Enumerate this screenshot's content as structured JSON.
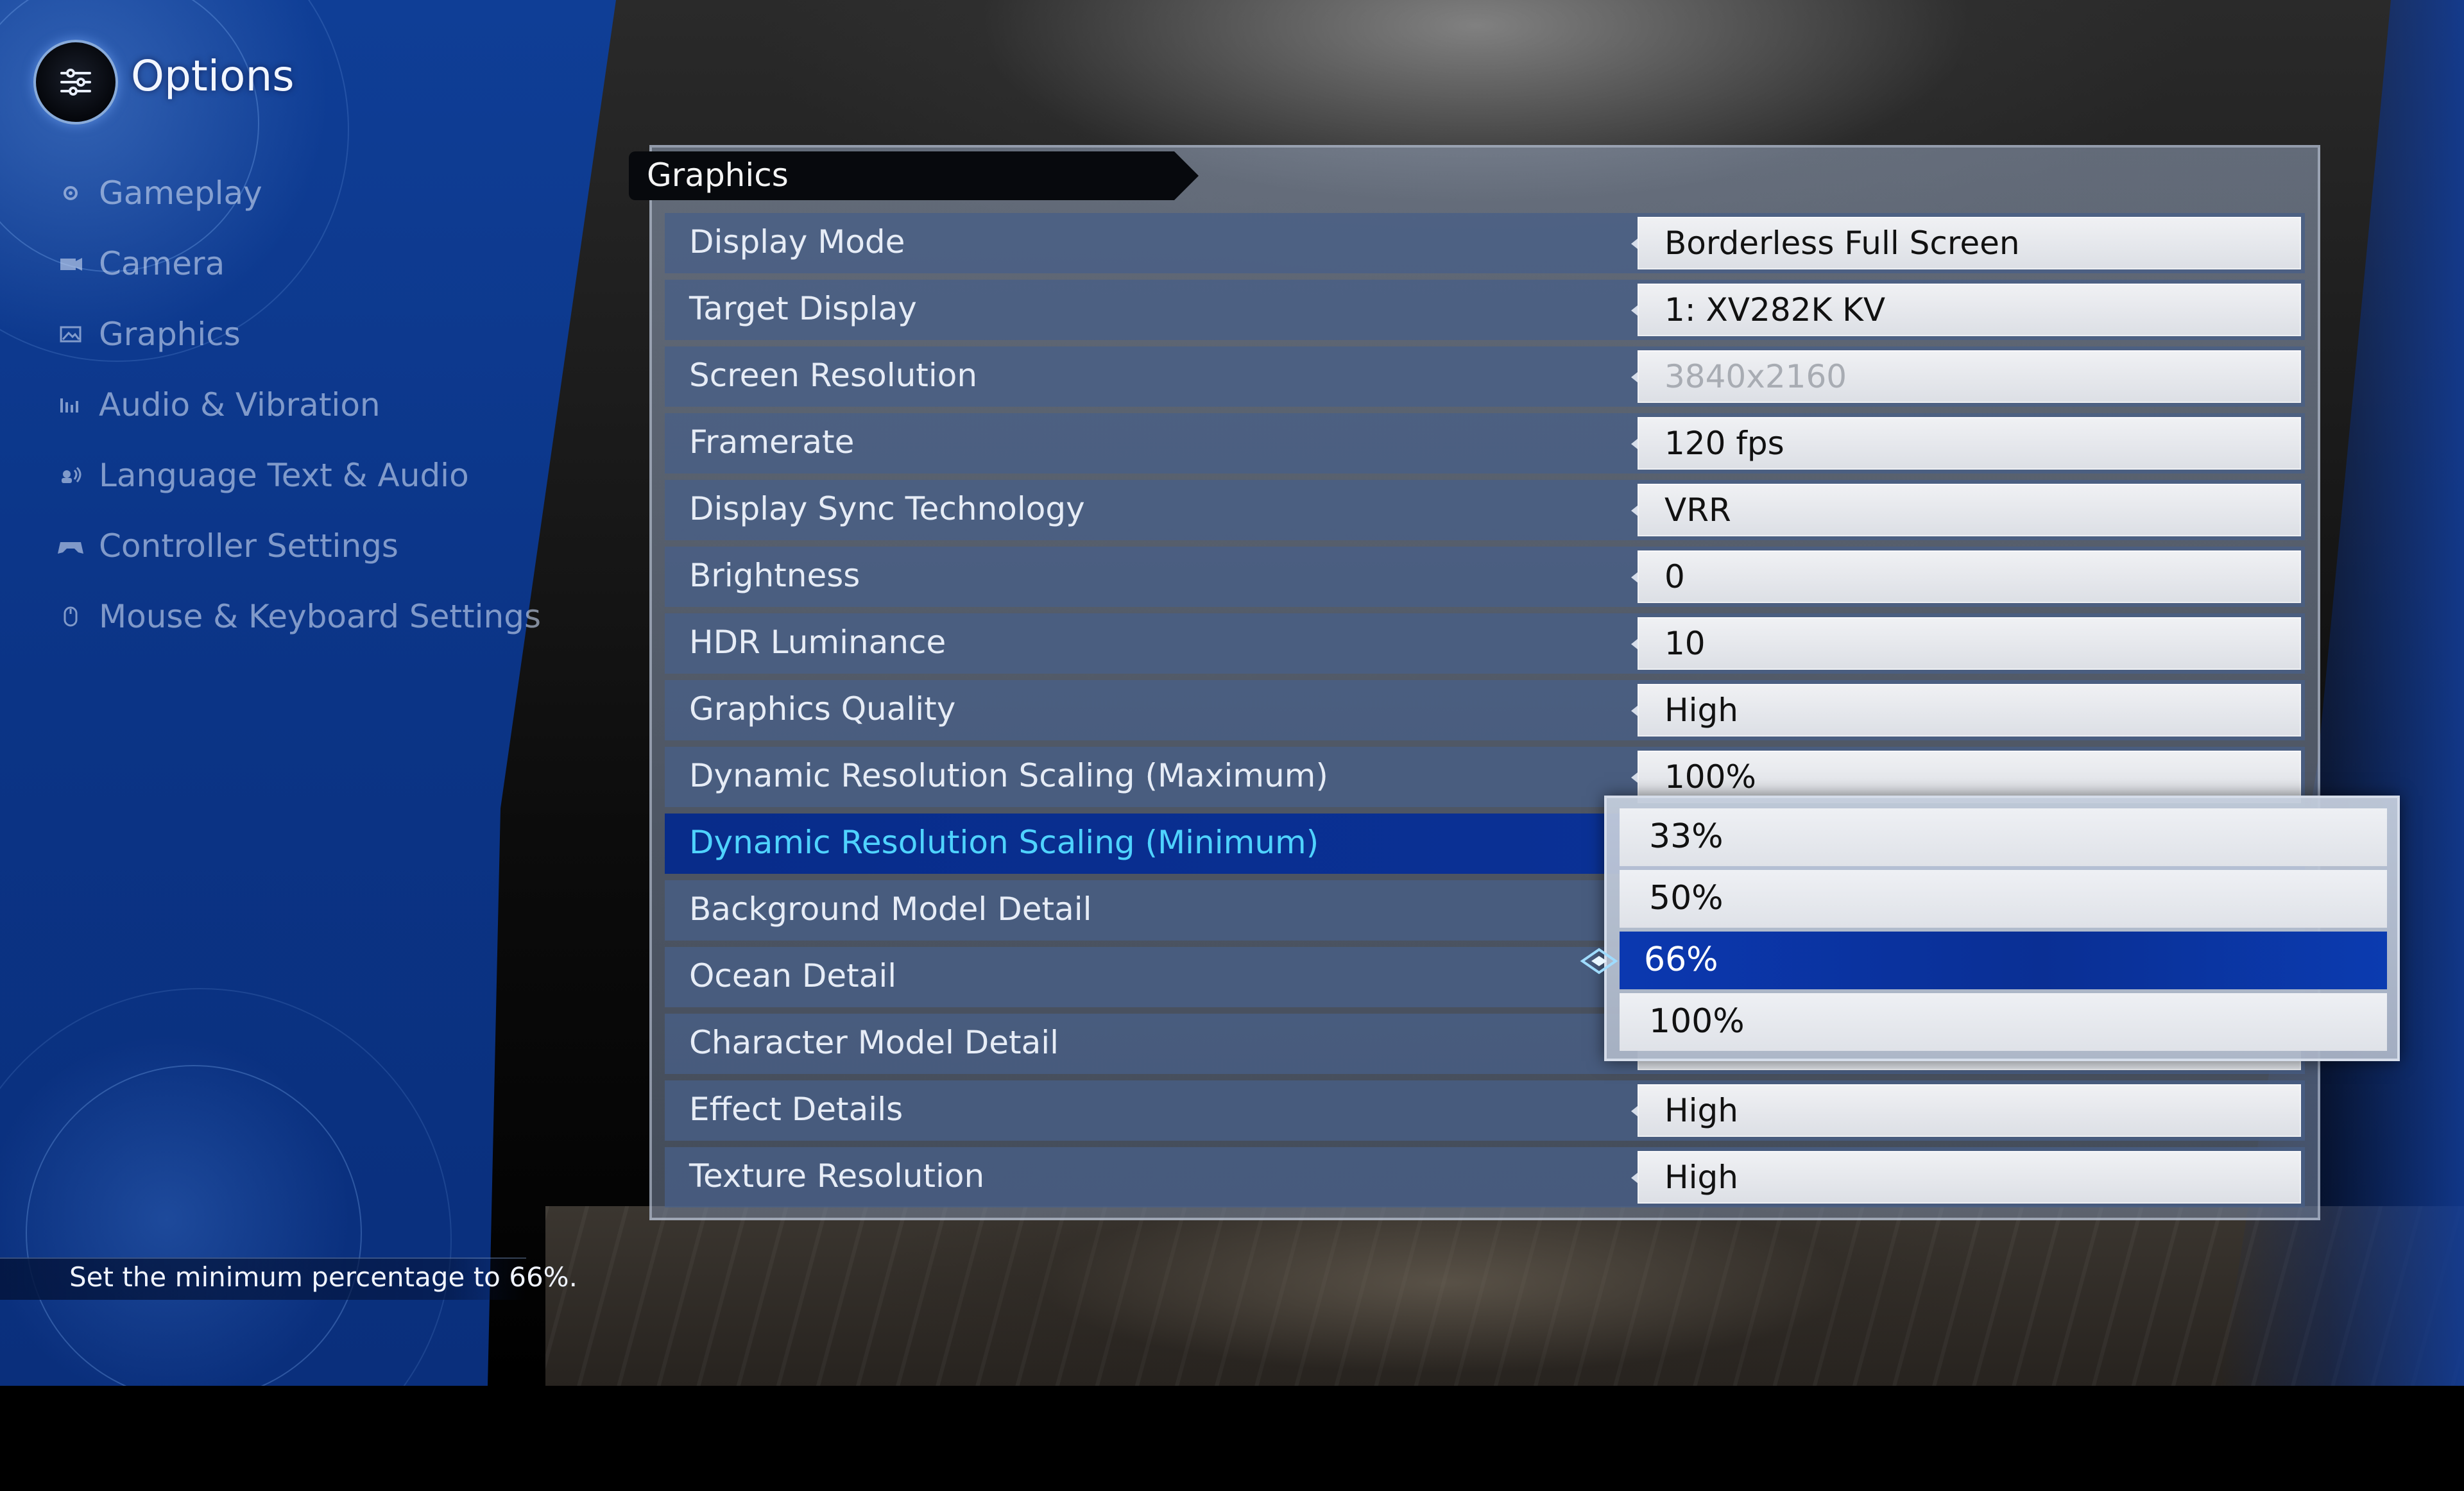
{
  "sidebar": {
    "title": "Options",
    "items": [
      {
        "label": "Gameplay",
        "icon": "gear-icon"
      },
      {
        "label": "Camera",
        "icon": "camera-icon"
      },
      {
        "label": "Graphics",
        "icon": "image-icon"
      },
      {
        "label": "Audio & Vibration",
        "icon": "audio-bars-icon"
      },
      {
        "label": "Language Text & Audio",
        "icon": "speech-icon"
      },
      {
        "label": "Controller Settings",
        "icon": "gamepad-icon"
      },
      {
        "label": "Mouse & Keyboard Settings",
        "icon": "mouse-icon"
      }
    ]
  },
  "panel": {
    "title": "Graphics",
    "rows": [
      {
        "label": "Display Mode",
        "value": "Borderless Full Screen"
      },
      {
        "label": "Target Display",
        "value": "1: XV282K KV"
      },
      {
        "label": "Screen Resolution",
        "value": "3840x2160"
      },
      {
        "label": "Framerate",
        "value": "120 fps"
      },
      {
        "label": "Display Sync Technology",
        "value": "VRR"
      },
      {
        "label": "Brightness",
        "value": "0"
      },
      {
        "label": "HDR Luminance",
        "value": "10"
      },
      {
        "label": "Graphics Quality",
        "value": "High"
      },
      {
        "label": "Dynamic Resolution Scaling (Maximum)",
        "value": "100%"
      },
      {
        "label": "Dynamic Resolution Scaling (Minimum)",
        "value": ""
      },
      {
        "label": "Background Model Detail",
        "value": ""
      },
      {
        "label": "Ocean Detail",
        "value": ""
      },
      {
        "label": "Character Model Detail",
        "value": ""
      },
      {
        "label": "Effect Details",
        "value": "High"
      },
      {
        "label": "Texture Resolution",
        "value": "High"
      }
    ]
  },
  "dropdown": {
    "options": [
      "33%",
      "50%",
      "66%",
      "100%"
    ],
    "selected": "66%"
  },
  "help": {
    "text": "Set the minimum percentage to 66%."
  },
  "colors": {
    "accent_blue": "#0a3196",
    "selected_label": "#4fd3ff",
    "sidebar_bg": "#0b3486"
  }
}
